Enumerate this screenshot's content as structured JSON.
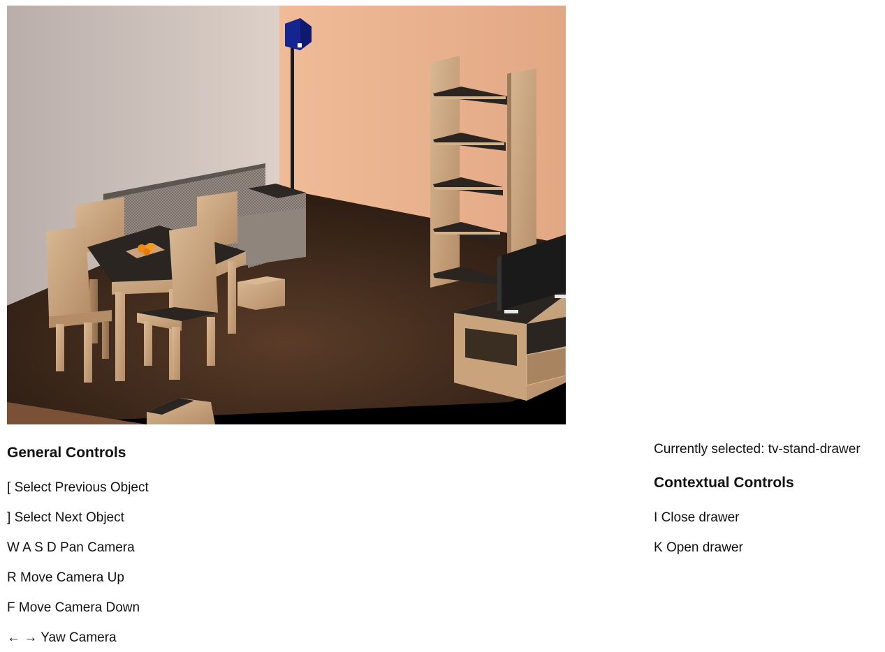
{
  "viewport": {
    "scene_objects": [
      "dining-table",
      "dining-chair",
      "fruit-bowl",
      "sofa",
      "floor-lamp",
      "bookshelf",
      "tv",
      "tv-stand",
      "tv-stand-drawer",
      "side-crate"
    ]
  },
  "general_controls": {
    "heading": "General Controls",
    "items": [
      {
        "key": "[",
        "action": "Select Previous Object"
      },
      {
        "key": "]",
        "action": "Select Next Object"
      },
      {
        "key": "W A S D",
        "action": "Pan Camera"
      },
      {
        "key": "R",
        "action": "Move Camera Up"
      },
      {
        "key": "F",
        "action": "Move Camera Down"
      },
      {
        "key": "← →",
        "action": "Yaw Camera"
      }
    ]
  },
  "selection": {
    "prefix": "Currently selected:",
    "object": "tv-stand-drawer",
    "label": "Currently selected: tv-stand-drawer"
  },
  "contextual_controls": {
    "heading": "Contextual Controls",
    "items": [
      {
        "key": "I",
        "action": "Close drawer"
      },
      {
        "key": "K",
        "action": "Open drawer"
      }
    ]
  },
  "colors": {
    "left_wall": "#c9bfb8",
    "back_wall": "#e6b291",
    "floor": "#3f2a1d",
    "wood": "#c9a37c",
    "dark_panel": "#2a2520",
    "lamp_shade": "#0f1a6e",
    "fruit": "#f08a12"
  }
}
